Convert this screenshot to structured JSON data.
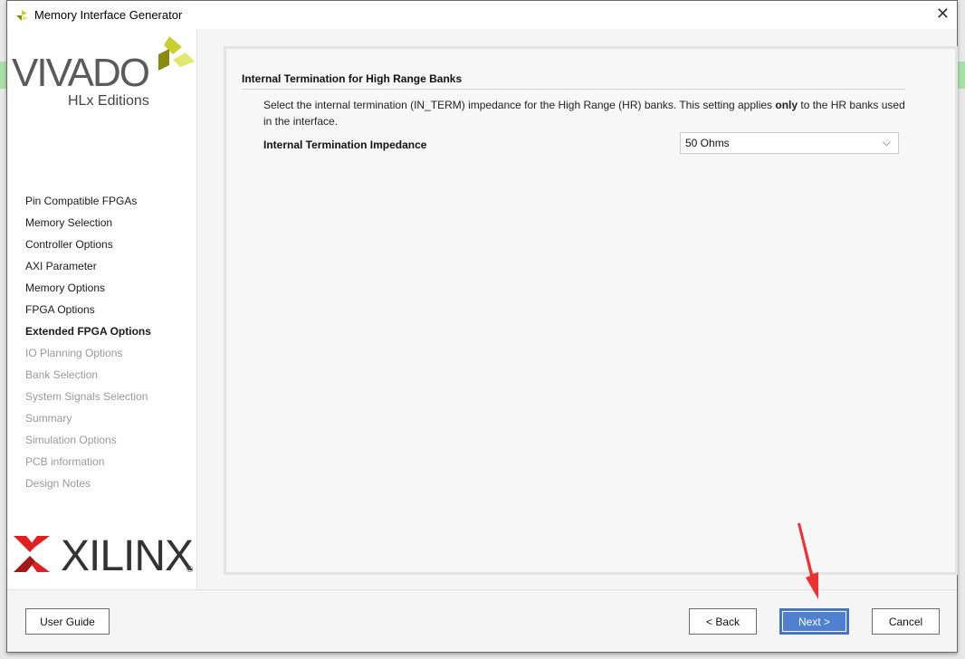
{
  "window": {
    "title": "Memory Interface Generator"
  },
  "branding": {
    "vivado": "VIVADO",
    "edition": "HLx Editions",
    "xilinx": "XILINX",
    "registered": "®"
  },
  "sidebar": {
    "items": [
      {
        "label": "Pin Compatible FPGAs",
        "state": "done"
      },
      {
        "label": "Memory Selection",
        "state": "done"
      },
      {
        "label": "Controller Options",
        "state": "done"
      },
      {
        "label": "AXI Parameter",
        "state": "done"
      },
      {
        "label": "Memory Options",
        "state": "done"
      },
      {
        "label": "FPGA Options",
        "state": "done"
      },
      {
        "label": "Extended FPGA Options",
        "state": "active"
      },
      {
        "label": "IO Planning Options",
        "state": "disabled"
      },
      {
        "label": "Bank Selection",
        "state": "disabled"
      },
      {
        "label": "System Signals Selection",
        "state": "disabled"
      },
      {
        "label": "Summary",
        "state": "disabled"
      },
      {
        "label": "Simulation Options",
        "state": "disabled"
      },
      {
        "label": "PCB information",
        "state": "disabled"
      },
      {
        "label": "Design Notes",
        "state": "disabled"
      }
    ]
  },
  "main": {
    "section_title": "Internal Termination for High Range Banks",
    "desc_pre": "Select the internal termination (IN_TERM) impedance for the High Range (HR) banks. This setting applies ",
    "desc_bold": "only",
    "desc_post": " to the HR banks used in the interface.",
    "field_label": "Internal Termination Impedance",
    "field_value": "50 Ohms"
  },
  "buttons": {
    "user_guide": "User Guide",
    "back": "< Back",
    "next": "Next >",
    "cancel": "Cancel"
  },
  "colors": {
    "primary": "#5080d0",
    "annotation_arrow": "#f03030"
  }
}
